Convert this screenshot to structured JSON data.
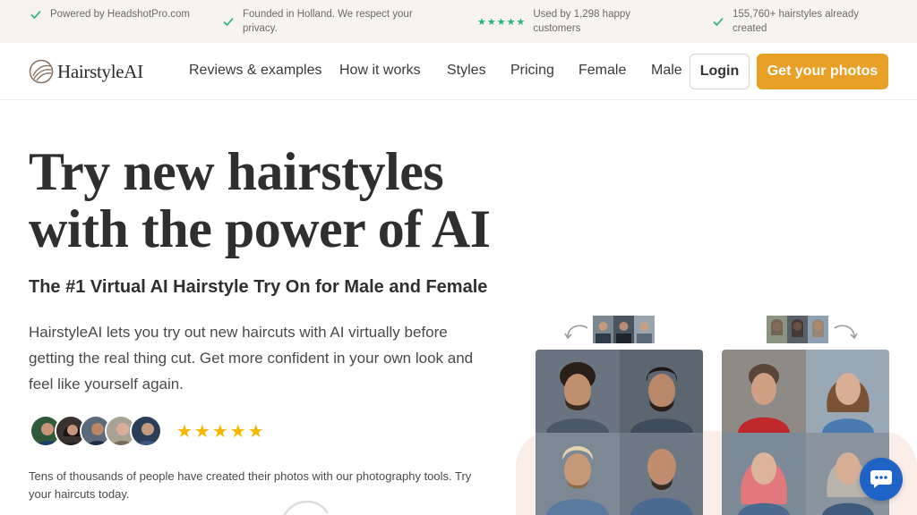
{
  "trust_bar": [
    {
      "text": "Powered by HeadshotPro.com",
      "icon": "check-icon"
    },
    {
      "text": "Founded in Holland. We respect your privacy.",
      "icon": "check-icon"
    },
    {
      "text": "Used by 1,298 happy customers",
      "icon": "star-rating",
      "stars": "★★★★★"
    },
    {
      "text": "155,760+ hairstyles already created",
      "icon": "check-icon"
    }
  ],
  "nav": {
    "logo_text": "HairstyleAI",
    "links": [
      "Reviews & examples",
      "How it works",
      "Styles",
      "Pricing",
      "Female",
      "Male"
    ],
    "login_label": "Login",
    "cta_label": "Get your photos"
  },
  "hero": {
    "title_line1": "Try new hairstyles",
    "title_line2": "with the power of AI",
    "subtitle": "The #1 Virtual AI Hairstyle Try On for Male and Female",
    "description": "HairstyleAI lets you try out new haircuts with AI virtually before getting the real thing cut. Get more confident in your own look and feel like yourself again.",
    "rating_stars": "★★★★★",
    "social_proof": "Tens of thousands of people have created their photos with our photography tools. Try your haircuts today."
  },
  "colors": {
    "accent": "#e8a126",
    "trust_check": "#22b573",
    "star": "#f5b800",
    "chat": "#1f63c6",
    "topbar_bg": "#f7f3ef"
  }
}
